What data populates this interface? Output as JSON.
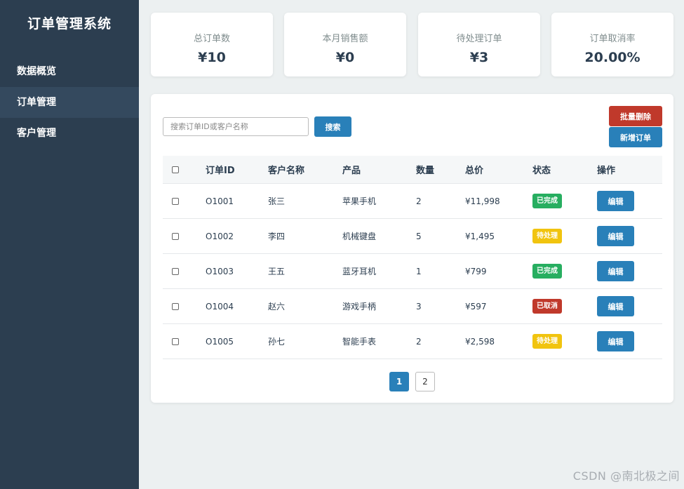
{
  "sidebar": {
    "brand": "订单管理系统",
    "items": [
      {
        "label": "数据概览"
      },
      {
        "label": "订单管理"
      },
      {
        "label": "客户管理"
      }
    ]
  },
  "stats": [
    {
      "label": "总订单数",
      "value": "¥10"
    },
    {
      "label": "本月销售额",
      "value": "¥0"
    },
    {
      "label": "待处理订单",
      "value": "¥3"
    },
    {
      "label": "订单取消率",
      "value": "20.00%"
    }
  ],
  "toolbar": {
    "search_placeholder": "搜索订单ID或客户名称",
    "search_label": "搜索",
    "delete_label": "批量删除",
    "add_label": "新增订单"
  },
  "table": {
    "headers": {
      "id": "订单ID",
      "customer": "客户名称",
      "product": "产品",
      "qty": "数量",
      "total": "总价",
      "status": "状态",
      "action": "操作"
    },
    "rows": [
      {
        "id": "O1001",
        "customer": "张三",
        "product": "苹果手机",
        "qty": "2",
        "total": "¥11,998",
        "status": "已完成",
        "action": "编辑"
      },
      {
        "id": "O1002",
        "customer": "李四",
        "product": "机械键盘",
        "qty": "5",
        "total": "¥1,495",
        "status": "待处理",
        "action": "编辑"
      },
      {
        "id": "O1003",
        "customer": "王五",
        "product": "蓝牙耳机",
        "qty": "1",
        "total": "¥799",
        "status": "已完成",
        "action": "编辑"
      },
      {
        "id": "O1004",
        "customer": "赵六",
        "product": "游戏手柄",
        "qty": "3",
        "total": "¥597",
        "status": "已取消",
        "action": "编辑"
      },
      {
        "id": "O1005",
        "customer": "孙七",
        "product": "智能手表",
        "qty": "2",
        "total": "¥2,598",
        "status": "待处理",
        "action": "编辑"
      }
    ]
  },
  "pagination": {
    "pages": [
      "1",
      "2"
    ]
  },
  "watermark": "CSDN @南北极之间",
  "colors": {
    "sidebar": "#2c3e50",
    "sidebar_active": "#34495e",
    "primary": "#2980b9",
    "danger": "#c0392b",
    "status_done": "#27ae60",
    "status_pending": "#f1c40f",
    "status_cancelled": "#c0392b"
  }
}
